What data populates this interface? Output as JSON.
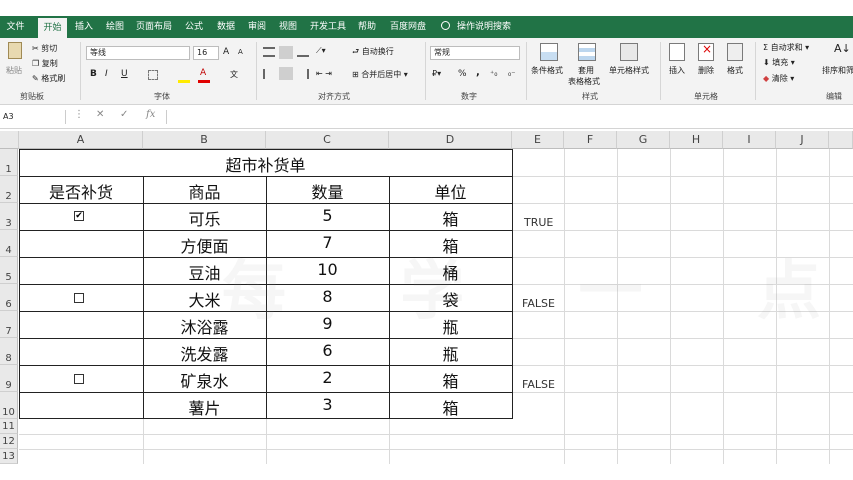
{
  "tabs": [
    {
      "label": "文件",
      "active": false
    },
    {
      "label": "开始",
      "active": true
    },
    {
      "label": "插入",
      "active": false
    },
    {
      "label": "绘图",
      "active": false
    },
    {
      "label": "页面布局",
      "active": false
    },
    {
      "label": "公式",
      "active": false
    },
    {
      "label": "数据",
      "active": false
    },
    {
      "label": "审阅",
      "active": false
    },
    {
      "label": "视图",
      "active": false
    },
    {
      "label": "开发工具",
      "active": false
    },
    {
      "label": "帮助",
      "active": false
    },
    {
      "label": "百度网盘",
      "active": false
    }
  ],
  "tell_me": "操作说明搜索",
  "ribbon": {
    "clipboard": {
      "paste": "粘贴",
      "cut": "剪切",
      "copy": "复制",
      "format_painter": "格式刷",
      "group": "剪贴板"
    },
    "font": {
      "name": "等线",
      "size": "16",
      "grow": "A",
      "shrink": "A",
      "bold": "B",
      "italic": "I",
      "underline": "U",
      "font_color": "A",
      "phonetic": "文",
      "group": "字体"
    },
    "alignment": {
      "wrap": "自动换行",
      "merge": "合并后居中",
      "group": "对齐方式"
    },
    "number": {
      "format": "常规",
      "percent": "%",
      "comma": ",",
      "group": "数字"
    },
    "styles": {
      "conditional": "条件格式",
      "table_format_1": "套用",
      "table_format_2": "表格格式",
      "cell_styles": "单元格样式",
      "group": "样式"
    },
    "cells": {
      "insert": "插入",
      "delete": "删除",
      "format": "格式",
      "group": "单元格"
    },
    "editing": {
      "autosum": "自动求和",
      "fill": "填充",
      "clear": "清除",
      "sort": "排序和筛",
      "group": "编辑"
    }
  },
  "name_box": "A3",
  "fx": "fx",
  "columns": [
    "A",
    "B",
    "C",
    "D",
    "E",
    "F",
    "G",
    "H",
    "I",
    "J"
  ],
  "rows": [
    "1",
    "2",
    "3",
    "4",
    "5",
    "6",
    "7",
    "8",
    "9",
    "10",
    "11",
    "12",
    "13"
  ],
  "table": {
    "title": "超市补货单",
    "headers": [
      "是否补货",
      "商品",
      "数量",
      "单位"
    ],
    "rows": [
      {
        "check": "✔",
        "item": "可乐",
        "qty": "5",
        "unit": "箱"
      },
      {
        "check": "",
        "item": "方便面",
        "qty": "7",
        "unit": "箱"
      },
      {
        "check": "",
        "item": "豆油",
        "qty": "10",
        "unit": "桶"
      },
      {
        "check": "",
        "item": "大米",
        "qty": "8",
        "unit": "袋"
      },
      {
        "check": "",
        "item": "沐浴露",
        "qty": "9",
        "unit": "瓶"
      },
      {
        "check": "",
        "item": "洗发露",
        "qty": "6",
        "unit": "瓶"
      },
      {
        "check": "",
        "item": "矿泉水",
        "qty": "2",
        "unit": "箱"
      },
      {
        "check": "",
        "item": "薯片",
        "qty": "3",
        "unit": "箱"
      }
    ]
  },
  "linked_values": {
    "row3": "TRUE",
    "row6": "FALSE",
    "row9": "FALSE"
  },
  "watermark": "每 学 一 点"
}
